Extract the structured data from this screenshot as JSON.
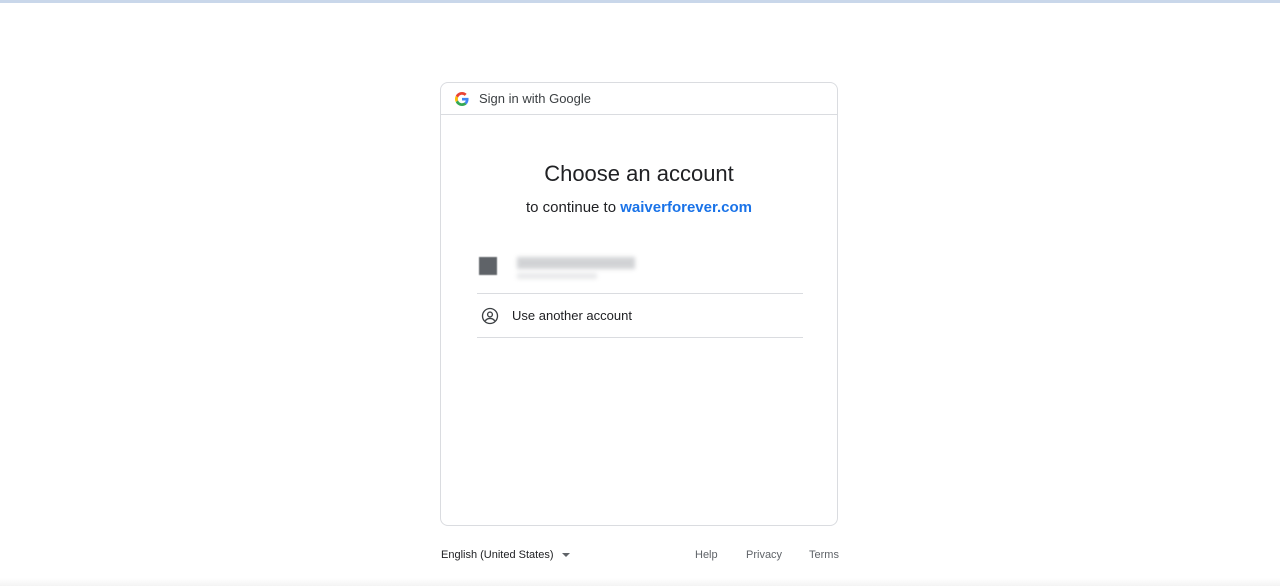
{
  "header": {
    "title": "Sign in with Google",
    "icon": "google-g-icon"
  },
  "main": {
    "title": "Choose an account",
    "subtitle_prefix": "to continue to",
    "subtitle_link": "waiverforever.com",
    "accounts": [
      {
        "name": "",
        "email": "",
        "avatar_icon": "avatar-icon"
      }
    ],
    "use_another_label": "Use another account",
    "use_another_icon": "person-circle-icon"
  },
  "footer": {
    "language": "English (United States)",
    "help": "Help",
    "privacy": "Privacy",
    "terms": "Terms"
  },
  "colors": {
    "link": "#1a73e8",
    "divider": "#dadce0",
    "text": "#202124",
    "muted": "#5f6368"
  }
}
